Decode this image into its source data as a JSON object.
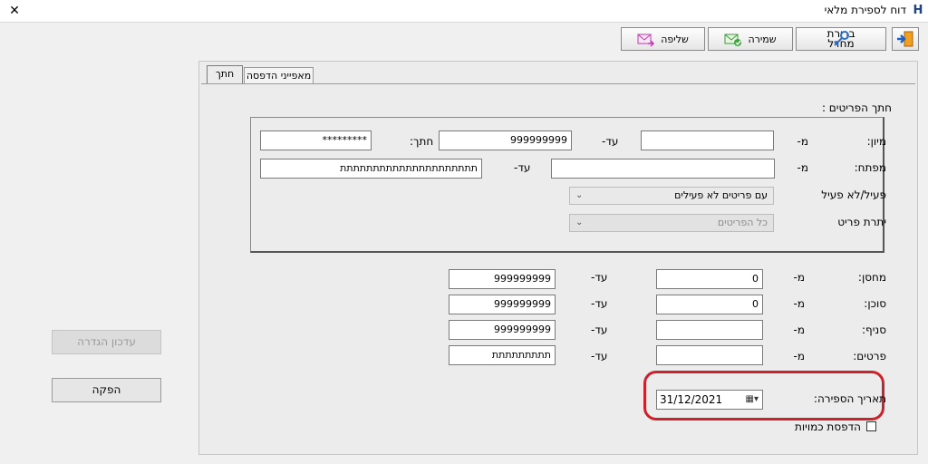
{
  "window": {
    "title": "דוח לספירת מלאי",
    "app_icon": "H"
  },
  "toolbar": {
    "close_label": "שליפה",
    "save_label": "שמירה",
    "default_label_line1": "ברירת",
    "default_label_line2": "מחדל"
  },
  "tabs": [
    {
      "label": "חתך"
    },
    {
      "label": "מאפייני הדפסה"
    }
  ],
  "section": {
    "title": "חתך הפריטים :"
  },
  "filter": {
    "sort_label": "מיון:",
    "from_label": "מ-",
    "to_label": "עד-",
    "sort_from": "",
    "sort_to": "999999999",
    "cut_label": "חתך:",
    "cut_value": "*********",
    "key_label": "מפתח:",
    "key_from": "",
    "key_to": "תתתתתתתתתתתתתתתתתתתתת",
    "active_label": "פעיל/לא פעיל",
    "active_value": "עם פריטים לא פעילים",
    "balance_label": "יתרת פריט",
    "balance_value": "כל הפריטים"
  },
  "ranges": {
    "warehouse_label": "מחסן:",
    "warehouse_from": "0",
    "warehouse_to": "999999999",
    "agent_label": "סוכן:",
    "agent_from": "0",
    "agent_to": "999999999",
    "branch_label": "סניף:",
    "branch_from": "",
    "branch_to": "999999999",
    "details_label": "פרטים:",
    "details_from": "",
    "details_to": "תתתתתתתתת"
  },
  "count_date": {
    "label": "תאריך הספירה:",
    "value": "31/12/2021"
  },
  "print_quantities": {
    "label": "הדפסת כמויות",
    "checked": false
  },
  "side": {
    "update_definition": "עדכון הגדרה",
    "run": "הפקה"
  }
}
